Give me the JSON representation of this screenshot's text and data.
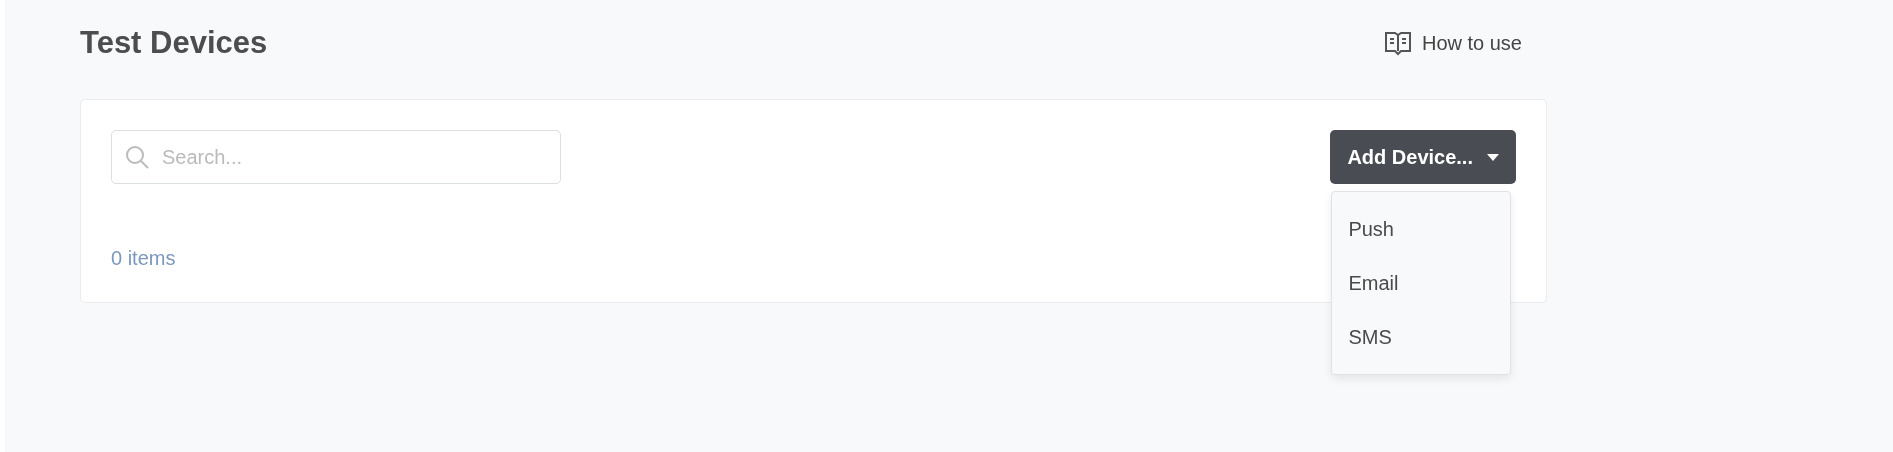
{
  "page": {
    "title": "Test Devices",
    "help_link": "How to use"
  },
  "search": {
    "placeholder": "Search..."
  },
  "add_button": {
    "label": "Add Device...",
    "expanded": true
  },
  "menu": [
    {
      "label": "Push"
    },
    {
      "label": "Email"
    },
    {
      "label": "SMS"
    }
  ],
  "count": "0 items"
}
